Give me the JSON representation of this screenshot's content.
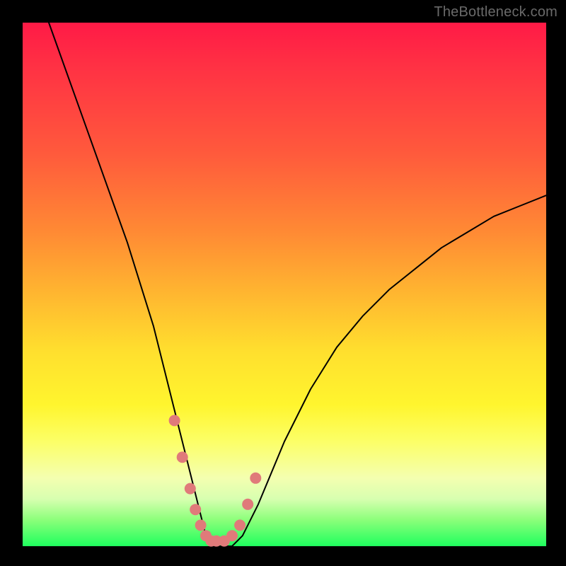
{
  "watermark": "TheBottleneck.com",
  "chart_data": {
    "type": "line",
    "title": "",
    "xlabel": "",
    "ylabel": "",
    "xlim": [
      0,
      100
    ],
    "ylim": [
      0,
      100
    ],
    "grid": false,
    "legend": false,
    "series": [
      {
        "name": "curve",
        "color": "#000000",
        "x": [
          5,
          10,
          15,
          20,
          25,
          28,
          30,
          32,
          34,
          35,
          36,
          38,
          40,
          42,
          45,
          50,
          55,
          60,
          65,
          70,
          75,
          80,
          85,
          90,
          95,
          100
        ],
        "y": [
          100,
          86,
          72,
          58,
          42,
          30,
          22,
          14,
          6,
          2,
          0,
          0,
          0,
          2,
          8,
          20,
          30,
          38,
          44,
          49,
          53,
          57,
          60,
          63,
          65,
          67
        ]
      }
    ],
    "markers": {
      "name": "highlight-dots",
      "color": "#e07a7a",
      "x": [
        29,
        30.5,
        32,
        33,
        34,
        35,
        36,
        37,
        38.5,
        40,
        41.5,
        43,
        44.5
      ],
      "y": [
        24,
        17,
        11,
        7,
        4,
        2,
        1,
        1,
        1,
        2,
        4,
        8,
        13
      ]
    }
  }
}
